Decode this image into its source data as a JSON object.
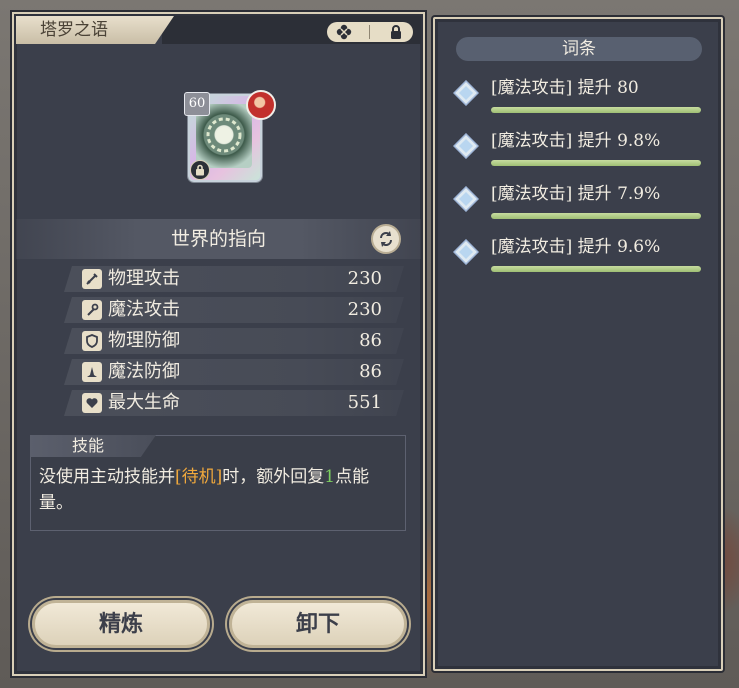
{
  "panel": {
    "tab_title": "塔罗之语",
    "icons": [
      "clover-icon",
      "lock-icon"
    ]
  },
  "card": {
    "level": "60",
    "avatar": "character-avatar-icon",
    "locked": true
  },
  "item": {
    "name": "世界的指向"
  },
  "stats": [
    {
      "icon": "sword-icon",
      "label": "物理攻击",
      "value": "230"
    },
    {
      "icon": "staff-icon",
      "label": "魔法攻击",
      "value": "230"
    },
    {
      "icon": "shield-icon",
      "label": "物理防御",
      "value": "86"
    },
    {
      "icon": "wizard-hat-icon",
      "label": "魔法防御",
      "value": "86"
    },
    {
      "icon": "heart-icon",
      "label": "最大生命",
      "value": "551"
    }
  ],
  "skill": {
    "title": "技能",
    "desc_before": "没使用主动技能并",
    "desc_bracket_open": "[",
    "desc_highlight": "待机",
    "desc_bracket_close": "]",
    "desc_middle": "时，额外回复",
    "desc_number": "1",
    "desc_after": "点能量。"
  },
  "buttons": {
    "refine": "精炼",
    "unequip": "卸下"
  },
  "affixes": {
    "title": "词条",
    "items": [
      {
        "text": "[魔法攻击] 提升 80",
        "fill": 1.0
      },
      {
        "text": "[魔法攻击] 提升 9.8%",
        "fill": 1.0
      },
      {
        "text": "[魔法攻击] 提升 7.9%",
        "fill": 1.0
      },
      {
        "text": "[魔法攻击] 提升 9.6%",
        "fill": 1.0
      }
    ]
  },
  "colors": {
    "panel_bg": "#3b3f4b",
    "highlight_orange": "#f0a83c",
    "highlight_green": "#7ccf5f",
    "affix_bar": "#a9c77e"
  }
}
